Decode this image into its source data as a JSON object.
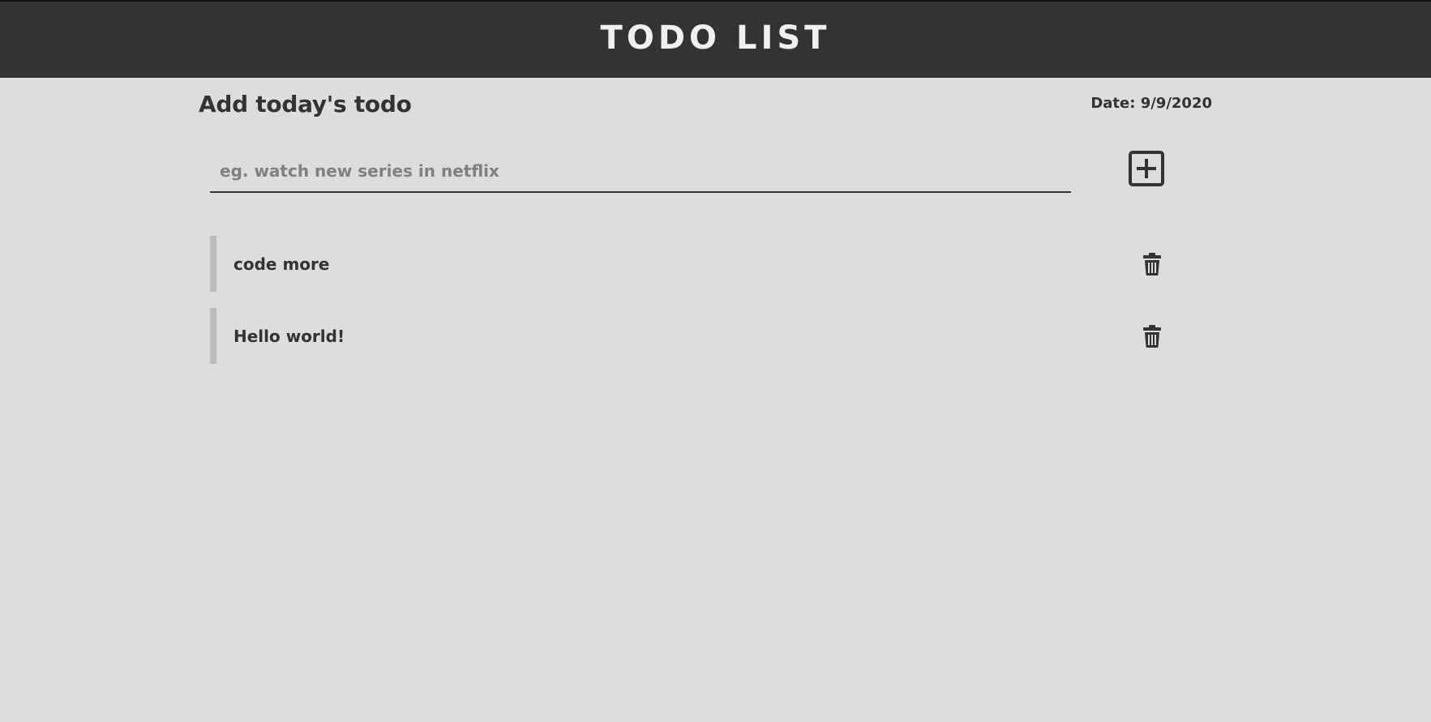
{
  "header": {
    "title": "TODO LIST"
  },
  "form": {
    "heading": "Add today's todo",
    "date": "Date: 9/9/2020",
    "input_placeholder": "eg. watch new series in netflix",
    "input_value": ""
  },
  "todos": [
    {
      "text": "code more"
    },
    {
      "text": "Hello world!"
    }
  ],
  "icons": {
    "add": "plus-square-icon",
    "delete": "trash-icon"
  },
  "colors": {
    "header_bg": "#333333",
    "page_bg": "#dddddd",
    "text": "#333333",
    "accent_border": "#bbbbbb",
    "placeholder": "#808080"
  }
}
